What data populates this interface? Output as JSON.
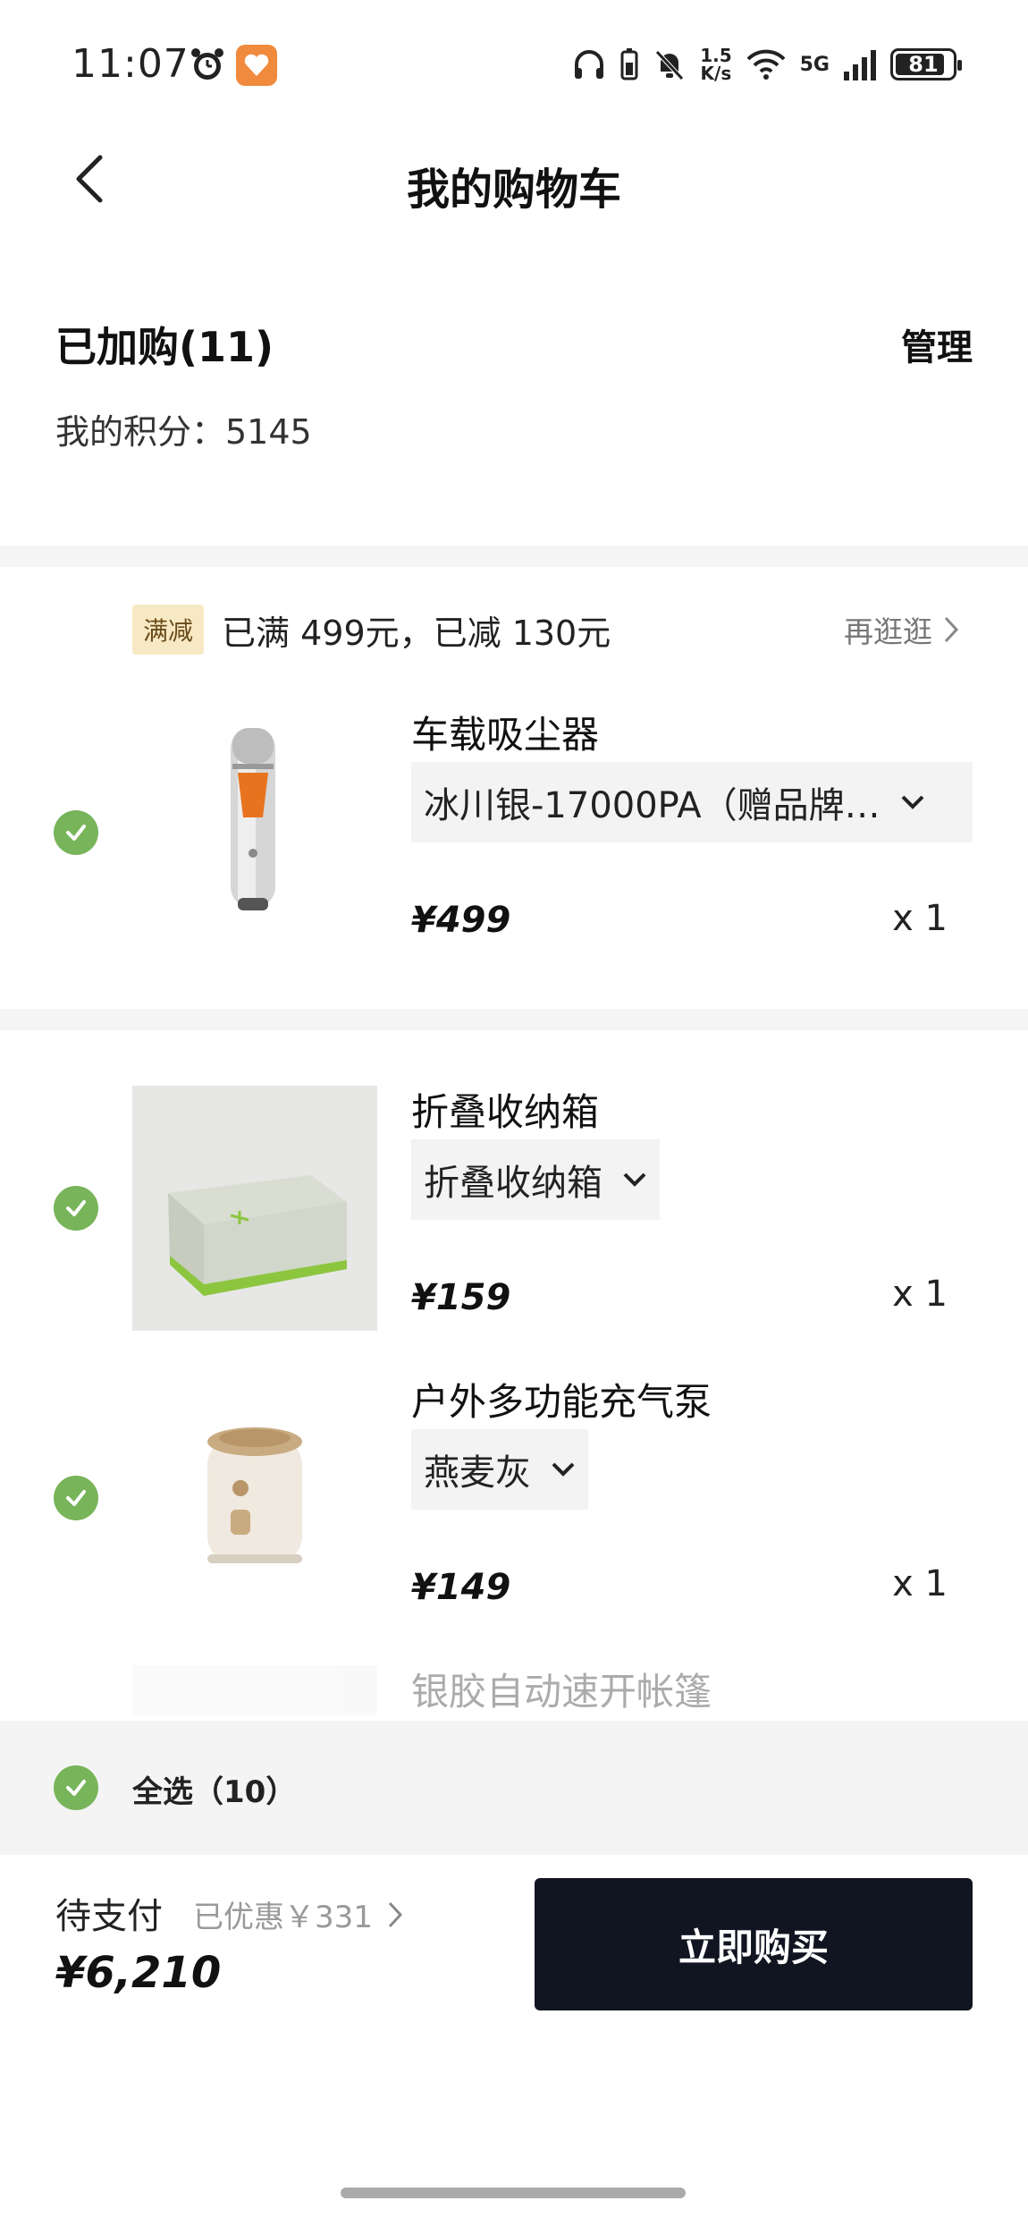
{
  "status_bar": {
    "time": "11:07",
    "speed_value": "1.5",
    "speed_unit": "K/s",
    "network": "5G",
    "battery": "81"
  },
  "header": {
    "title": "我的购物车"
  },
  "cart": {
    "count_label": "已加购(11)",
    "manage_label": "管理",
    "points_label": "我的积分：5145"
  },
  "promo": {
    "tag": "满减",
    "text": "已满 499元，已减 130元",
    "more": "再逛逛"
  },
  "items": [
    {
      "title": "车载吸尘器",
      "variant": "冰川银-17000PA（赠品牌…",
      "price": "¥499",
      "qty": "x 1"
    },
    {
      "title": "折叠收纳箱",
      "variant": "折叠收纳箱",
      "price": "¥159",
      "qty": "x 1"
    },
    {
      "title": "户外多功能充气泵",
      "variant": "燕麦灰",
      "price": "¥149",
      "qty": "x 1"
    },
    {
      "title": "银胶自动速开帐篷"
    }
  ],
  "select_all": {
    "label": "全选（10）"
  },
  "footer": {
    "pending_label": "待支付",
    "discount_label": "已优惠￥331",
    "total": "¥6,210",
    "buy_label": "立即购买"
  },
  "colors": {
    "check_green": "#78b45a",
    "buy_button": "#111521",
    "promo_tag_bg": "#f7e9c3"
  }
}
